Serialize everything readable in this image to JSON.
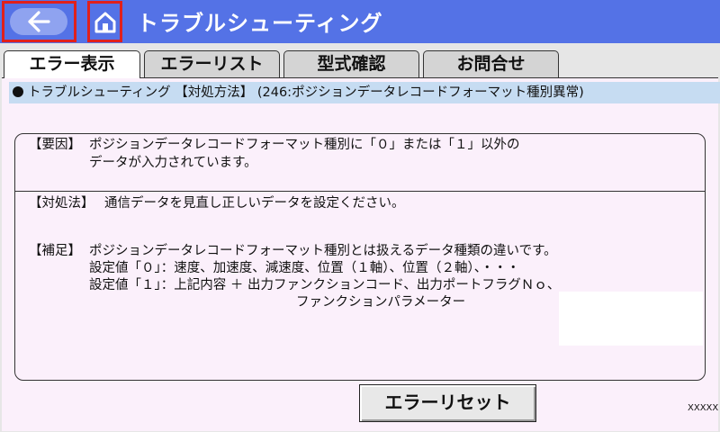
{
  "header": {
    "title": "トラブルシューティング",
    "back_icon": "arrow-left-icon",
    "home_icon": "home-icon"
  },
  "tabs": [
    {
      "label": "エラー表示",
      "active": true
    },
    {
      "label": "エラーリスト",
      "active": false
    },
    {
      "label": "型式確認",
      "active": false
    },
    {
      "label": "お問合せ",
      "active": false
    }
  ],
  "info_bar": {
    "text": "トラブルシューティング 【対処方法】 (246:ポジションデータレコードフォーマット種別異常)"
  },
  "cause": {
    "label": "【要因】",
    "lines": [
      "ポジションデータレコードフォーマット種別に「０」または「１」以外の",
      "データが入力されています。"
    ]
  },
  "remedy": {
    "label": "【対処法】",
    "text": "通信データを見直し正しいデータを設定ください。"
  },
  "supplement": {
    "label": "【補足】",
    "lines": [
      "ポジションデータレコードフォーマット種別とは扱えるデータ種類の違いです。",
      "設定値「０」：速度、加速度、減速度、位置（１軸）、位置（２軸）、・・・",
      "設定値「１」：上記内容 ＋ 出力ファンクションコード、出力ポートフラグＮｏ、",
      "ファンクションパラメーター"
    ]
  },
  "reset_button": "エラーリセット",
  "code": "XXXXX",
  "colors": {
    "header": "#5472e6",
    "highlight": "#e0201c",
    "info_bar": "#c6dcf2",
    "panel": "#fbf0fb"
  }
}
